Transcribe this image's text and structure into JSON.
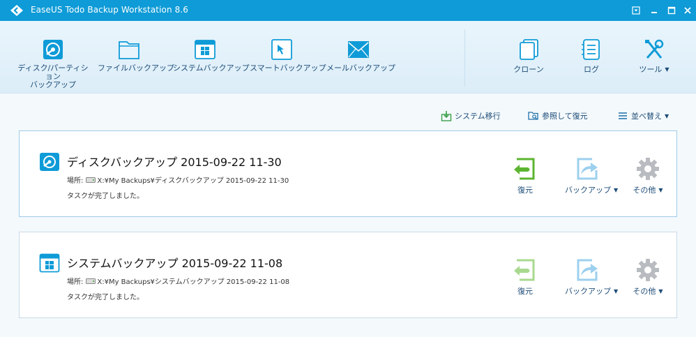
{
  "window": {
    "title": "EaseUS Todo Backup Workstation 8.6"
  },
  "toolbar": {
    "disk": "ディスク/パーティション\nバックアップ",
    "file": "ファイルバックアップ",
    "system": "システムバックアップ",
    "smart": "スマートバックアップ",
    "mail": "メールバックアップ",
    "clone": "クローン",
    "log": "ログ",
    "tools": "ツール"
  },
  "actions": {
    "migrate": "システム移行",
    "browse_restore": "参照して復元",
    "sort": "並べ替え"
  },
  "tasks": [
    {
      "title": "ディスクバックアップ 2015-09-22 11-30",
      "location_label": "場所:",
      "location": "X:¥My Backups¥ディスクバックアップ 2015-09-22 11-30",
      "status": "タスクが完了しました。",
      "restore": "復元",
      "backup": "バックアップ",
      "other": "その他"
    },
    {
      "title": "システムバックアップ 2015-09-22 11-08",
      "location_label": "場所:",
      "location": "X:¥My Backups¥システムバックアップ 2015-09-22 11-08",
      "status": "タスクが完了しました。",
      "restore": "復元",
      "backup": "バックアップ",
      "other": "その他"
    }
  ],
  "icons": {
    "accent": "#0e9bd7",
    "restore_green": "#5cb531",
    "restore_green_light": "#a9d98f",
    "backup_blue_light": "#9dd0ef",
    "gear_gray": "#b8bcc0"
  }
}
